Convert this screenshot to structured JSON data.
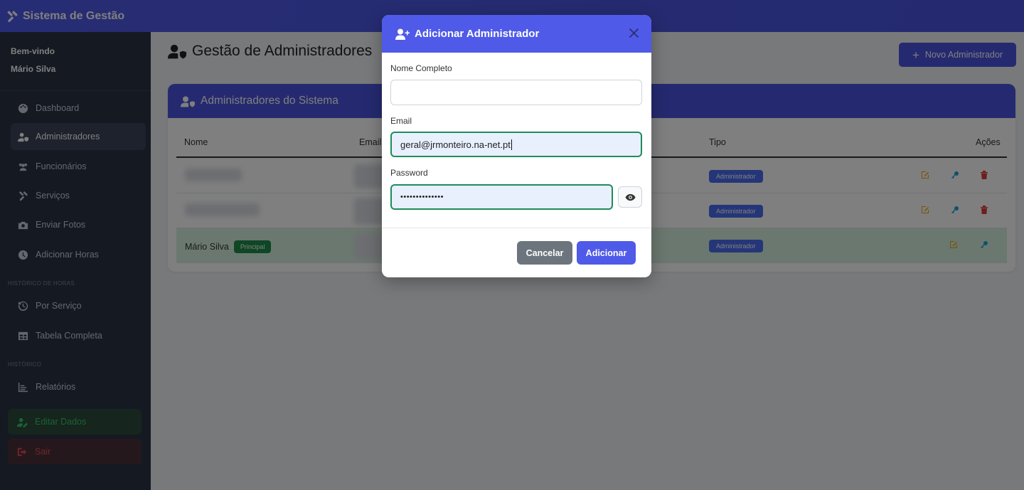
{
  "app": {
    "brand": "Sistema de Gestão"
  },
  "sidebar": {
    "welcome": "Bem-vindo",
    "user_name": "Mário Silva",
    "items": [
      {
        "label": "Dashboard",
        "icon": "palette-icon"
      },
      {
        "label": "Administradores",
        "icon": "user-shield-icon",
        "active": true
      },
      {
        "label": "Funcionários",
        "icon": "users-icon"
      },
      {
        "label": "Serviços",
        "icon": "tools-icon"
      },
      {
        "label": "Enviar Fotos",
        "icon": "camera-icon"
      },
      {
        "label": "Adicionar Horas",
        "icon": "clock-icon"
      }
    ],
    "section_hours": "HISTÓRICO DE HORAS",
    "hours_items": [
      {
        "label": "Por Serviço",
        "icon": "history-icon"
      },
      {
        "label": "Tabela Completa",
        "icon": "table-icon"
      }
    ],
    "section_history": "HISTÓRICO",
    "history_items": [
      {
        "label": "Relatórios",
        "icon": "chart-icon"
      }
    ],
    "edit_label": "Editar Dados",
    "exit_label": "Sair"
  },
  "main": {
    "title": "Gestão de Administradores",
    "new_button": "Novo Administrador",
    "card_title": "Administradores do Sistema",
    "columns": {
      "name": "Nome",
      "email": "Email",
      "type": "Tipo",
      "actions": "Ações"
    },
    "rows": [
      {
        "name": "",
        "type": "Administrador",
        "blurred": true
      },
      {
        "name": "",
        "type": "Administrador",
        "blurred": true
      },
      {
        "name": "Mário Silva",
        "badge": "Principal",
        "type": "Administrador",
        "blurred": false
      }
    ]
  },
  "modal": {
    "title": "Adicionar Administrador",
    "name_label": "Nome Completo",
    "name_value": "",
    "email_label": "Email",
    "email_value": "geral@jrmonteiro.na-net.pt",
    "password_label": "Password",
    "password_value": "••••••••••••••",
    "cancel": "Cancelar",
    "add": "Adicionar"
  },
  "colors": {
    "primary": "#4f5ae8",
    "sidebar": "#2b3445",
    "success": "#1e8c4a",
    "danger": "#e04c55"
  }
}
